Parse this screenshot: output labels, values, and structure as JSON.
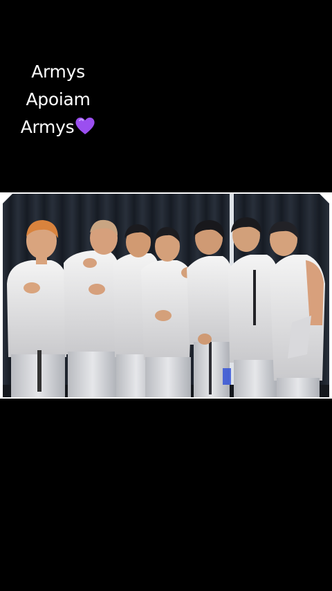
{
  "caption": {
    "line1": "Armys",
    "line2": "Apoiam",
    "line3": "Armys",
    "emoji": "purple-heart"
  },
  "photo": {
    "subject": "group-photo",
    "people_count": 7
  },
  "colors": {
    "background": "#000000",
    "caption_text": "#ffffff",
    "heart": "#9b4ff0",
    "curtain": "#1d2430",
    "outfits": "#e8e8e8"
  }
}
